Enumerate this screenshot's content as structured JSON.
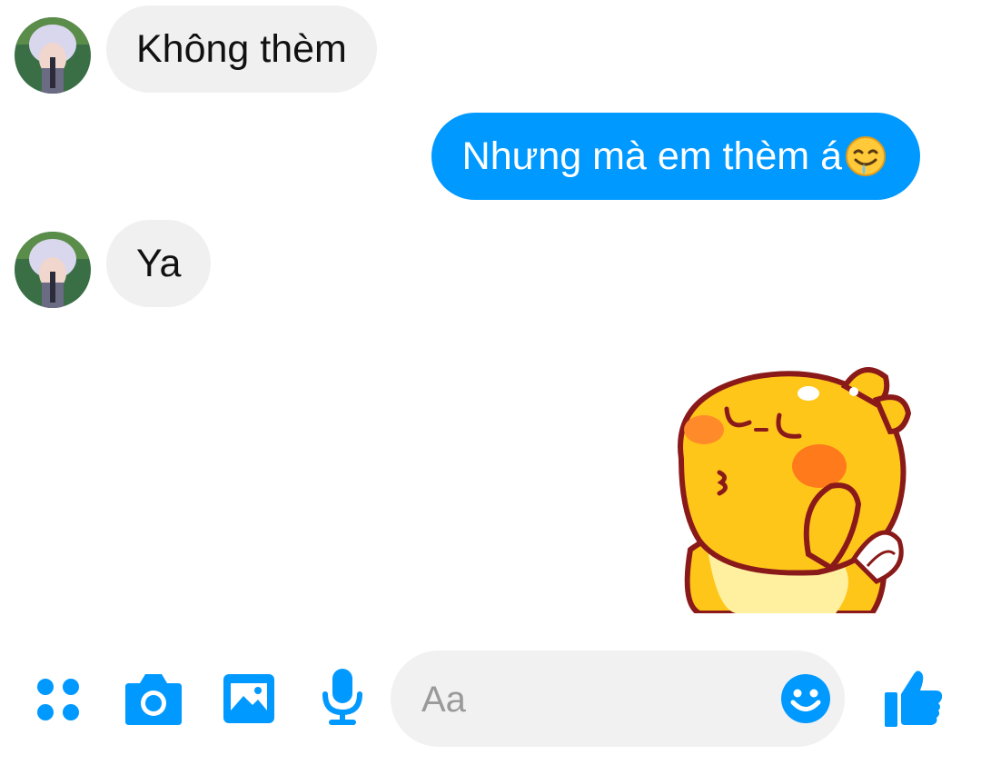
{
  "conversation": {
    "messages": [
      {
        "sender": "contact",
        "text": "Không thèm"
      },
      {
        "sender": "me",
        "text": "Nhưng mà em thèm á",
        "emoji": "drooling-face-emoji"
      },
      {
        "sender": "contact",
        "text": "Ya"
      },
      {
        "sender": "me",
        "sticker": "qoobee-kiss-sticker"
      }
    ]
  },
  "composer": {
    "placeholder": "Aa",
    "icons": [
      "more-apps-icon",
      "camera-icon",
      "gallery-icon",
      "microphone-icon",
      "emoji-icon",
      "like-icon"
    ]
  },
  "colors": {
    "accent": "#0099ff",
    "incoming_bubble": "#f1f0f0",
    "input_background": "#f1f1f1"
  }
}
